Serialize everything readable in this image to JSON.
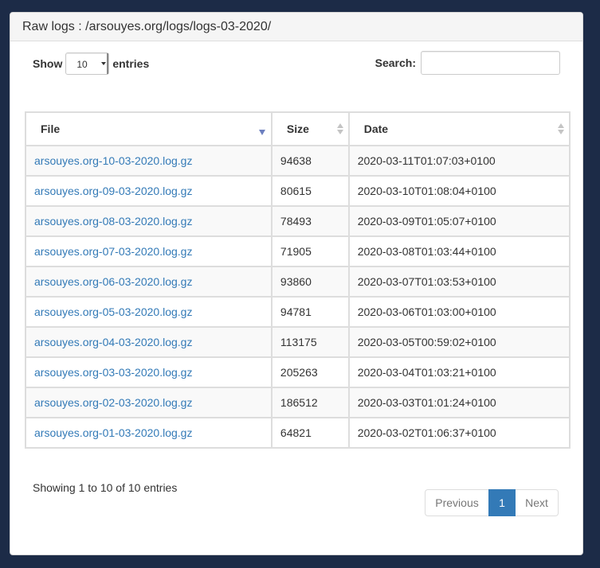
{
  "panel": {
    "title": "Raw logs : /arsouyes.org/logs/logs-03-2020/"
  },
  "length": {
    "show_label": "Show",
    "selected": "10",
    "entries_label": "entries"
  },
  "search": {
    "label": "Search:",
    "value": "",
    "placeholder": ""
  },
  "table": {
    "columns": [
      "File",
      "Size",
      "Date"
    ],
    "rows": [
      {
        "file": "arsouyes.org-10-03-2020.log.gz",
        "size": "94638",
        "date": "2020-03-11T01:07:03+0100"
      },
      {
        "file": "arsouyes.org-09-03-2020.log.gz",
        "size": "80615",
        "date": "2020-03-10T01:08:04+0100"
      },
      {
        "file": "arsouyes.org-08-03-2020.log.gz",
        "size": "78493",
        "date": "2020-03-09T01:05:07+0100"
      },
      {
        "file": "arsouyes.org-07-03-2020.log.gz",
        "size": "71905",
        "date": "2020-03-08T01:03:44+0100"
      },
      {
        "file": "arsouyes.org-06-03-2020.log.gz",
        "size": "93860",
        "date": "2020-03-07T01:03:53+0100"
      },
      {
        "file": "arsouyes.org-05-03-2020.log.gz",
        "size": "94781",
        "date": "2020-03-06T01:03:00+0100"
      },
      {
        "file": "arsouyes.org-04-03-2020.log.gz",
        "size": "113175",
        "date": "2020-03-05T00:59:02+0100"
      },
      {
        "file": "arsouyes.org-03-03-2020.log.gz",
        "size": "205263",
        "date": "2020-03-04T01:03:21+0100"
      },
      {
        "file": "arsouyes.org-02-03-2020.log.gz",
        "size": "186512",
        "date": "2020-03-03T01:01:24+0100"
      },
      {
        "file": "arsouyes.org-01-03-2020.log.gz",
        "size": "64821",
        "date": "2020-03-02T01:06:37+0100"
      }
    ]
  },
  "info": "Showing 1 to 10 of 10 entries",
  "pagination": {
    "previous": "Previous",
    "current": "1",
    "next": "Next"
  }
}
